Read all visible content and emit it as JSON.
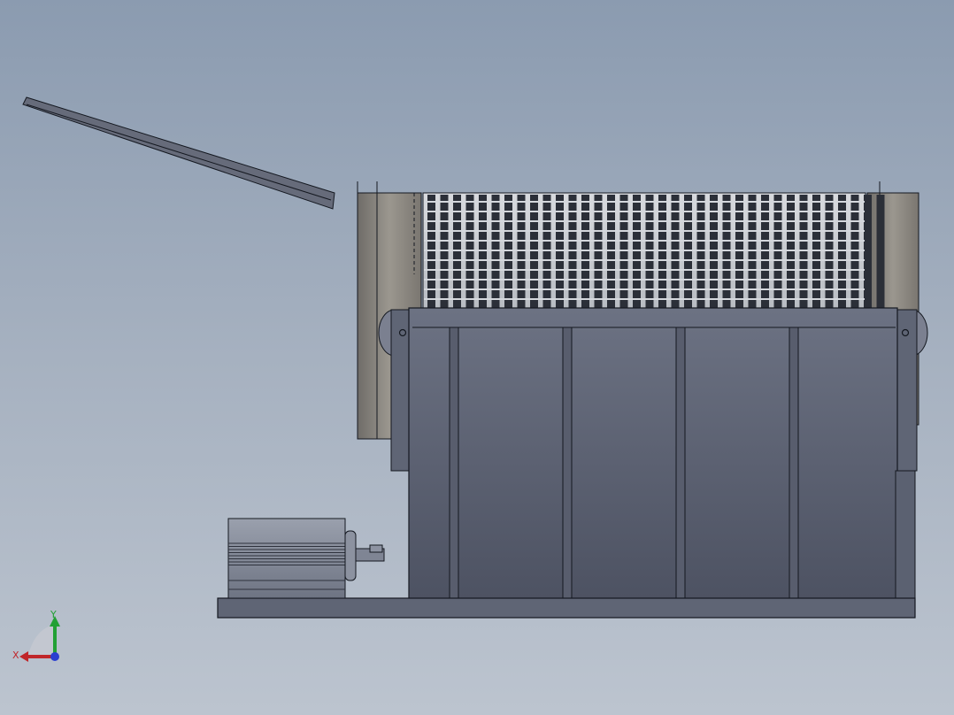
{
  "viewport": {
    "background_top": "#8b9bb0",
    "background_bottom": "#bcc4cf"
  },
  "model": {
    "components": [
      "feed-chute",
      "rotary-drum-screen",
      "support-frame",
      "gear-motor",
      "base-plate"
    ],
    "colors": {
      "steel": "#5f6575",
      "steel_dark": "#4b5060",
      "outline": "#141820",
      "drum_end": "#8a8680"
    }
  },
  "triad": {
    "x_label": "X",
    "y_label": "Y",
    "x_color": "#c0262a",
    "y_color": "#22a034",
    "z_color": "#2a3fd0"
  }
}
